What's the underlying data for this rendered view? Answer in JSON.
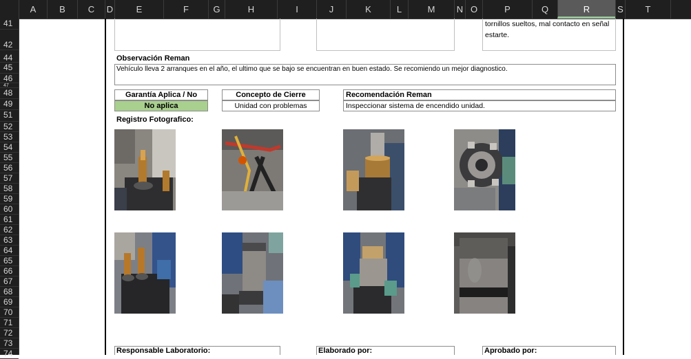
{
  "columns": [
    "A",
    "B",
    "C",
    "D",
    "E",
    "F",
    "G",
    "H",
    "I",
    "J",
    "K",
    "L",
    "M",
    "N",
    "O",
    "P",
    "Q",
    "R",
    "S",
    "T"
  ],
  "selected_column": "R",
  "rows": [
    "41",
    "42",
    "44",
    "45",
    "46",
    "47",
    "48",
    "49",
    "51",
    "52",
    "53",
    "54",
    "55",
    "56",
    "57",
    "58",
    "59",
    "60",
    "61",
    "62",
    "63",
    "64",
    "65",
    "66",
    "67",
    "68",
    "69",
    "70",
    "71",
    "72",
    "73",
    "74"
  ],
  "top_note": {
    "line1": "tornillos sueltos, mal contacto en señal",
    "line2": "estarte."
  },
  "observacion": {
    "label": "Observación Reman",
    "text": "Vehículo lleva 2 arranques en el año, el ultimo que se bajo se encuentran en buen estado. Se recomiendo un mejor diagnostico."
  },
  "garantia": {
    "label": "Garantía Aplica / No aplica",
    "value": "No aplica",
    "value_color": "#a9d08e"
  },
  "concepto": {
    "label": "Concepto de Cierre",
    "value": "Unidad con problemas"
  },
  "recomendacion": {
    "label": "Recomendación Reman",
    "value": "Inspeccionar sistema de encendido unidad."
  },
  "registro": {
    "label": "Registro Fotografico:"
  },
  "photos": [
    {
      "name": "photo-starter-terminals"
    },
    {
      "name": "photo-wiring-pliers"
    },
    {
      "name": "photo-armature-gear"
    },
    {
      "name": "photo-brush-plate"
    },
    {
      "name": "photo-terminal-nuts"
    },
    {
      "name": "photo-starter-motor-held"
    },
    {
      "name": "photo-starter-drive-gear"
    },
    {
      "name": "photo-starter-housing-closeup"
    }
  ],
  "signatures": {
    "responsable": "Responsable Laboratorio:",
    "elaborado": "Elaborado por:",
    "aprobado": "Aprobado por:"
  }
}
